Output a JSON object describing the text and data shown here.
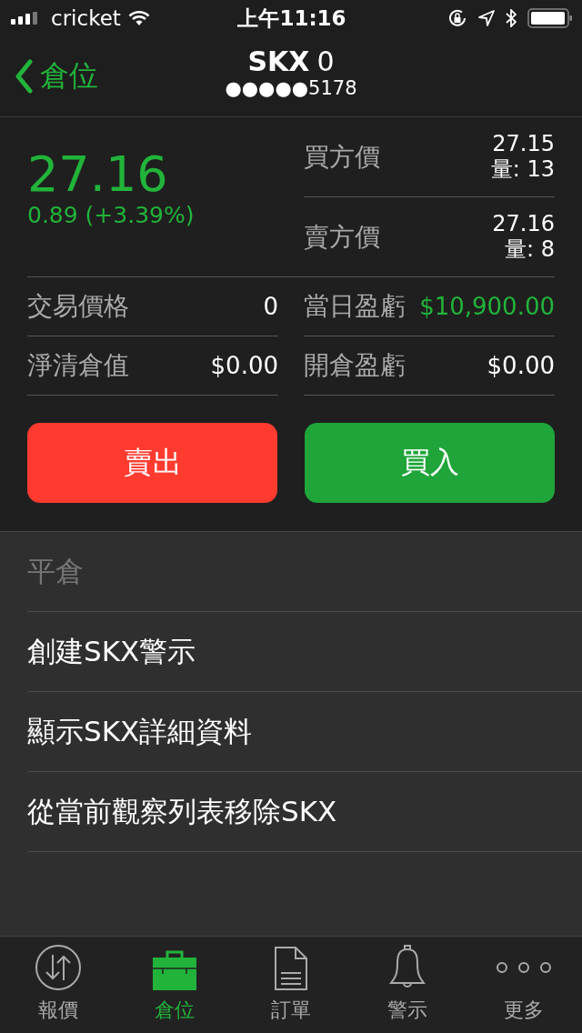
{
  "status_bar": {
    "carrier": "cricket",
    "time": "上午11:16"
  },
  "nav": {
    "back": "倉位",
    "title": "SKX",
    "title_count": "0",
    "account": "●●●●●5178"
  },
  "quote": {
    "price": "27.16",
    "change": "0.89 (+3.39%)"
  },
  "bid_ask": [
    {
      "label": "買方價",
      "price": "27.15",
      "size": "量: 13"
    },
    {
      "label": "賣方價",
      "price": "27.16",
      "size": "量: 8"
    }
  ],
  "stats": [
    {
      "label": "交易價格",
      "value": "0",
      "kind": "neutral"
    },
    {
      "label": "當日盈虧",
      "value": "$10,900.00",
      "kind": "gain"
    },
    {
      "label": "淨清倉值",
      "value": "$0.00",
      "kind": "neutral"
    },
    {
      "label": "開倉盈虧",
      "value": "$0.00",
      "kind": "neutral"
    }
  ],
  "actions": [
    {
      "label": "賣出",
      "kind": "sell"
    },
    {
      "label": "買入",
      "kind": "buy"
    }
  ],
  "menu": [
    {
      "label": "平倉",
      "disabled": true
    },
    {
      "label": "創建SKX警示",
      "disabled": false
    },
    {
      "label": "顯示SKX詳細資料",
      "disabled": false
    },
    {
      "label": "從當前觀察列表移除SKX",
      "disabled": false
    }
  ],
  "tabs": [
    {
      "label": "報價",
      "kind": "quotes",
      "selected": false
    },
    {
      "label": "倉位",
      "kind": "positions",
      "selected": true
    },
    {
      "label": "訂單",
      "kind": "orders",
      "selected": false
    },
    {
      "label": "警示",
      "kind": "alerts",
      "selected": false
    },
    {
      "label": "更多",
      "kind": "more",
      "selected": false
    }
  ]
}
